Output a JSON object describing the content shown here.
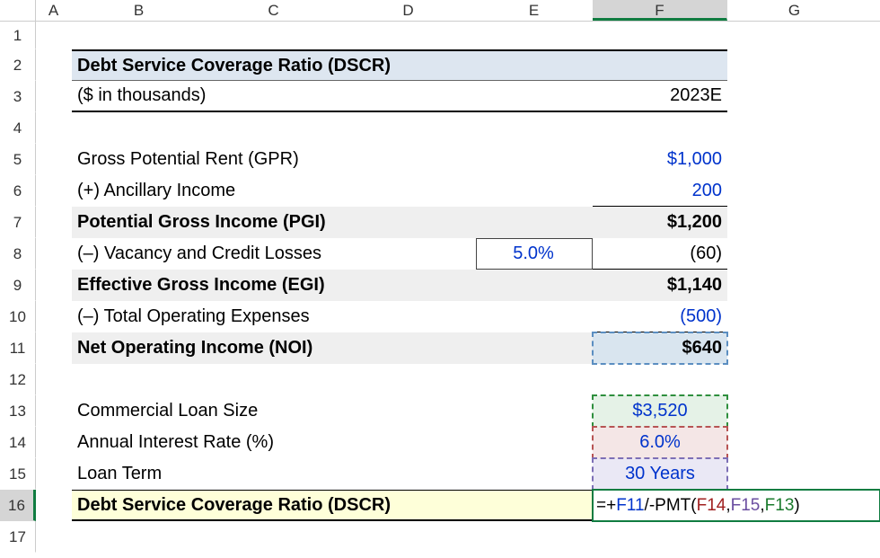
{
  "columns": [
    "A",
    "B",
    "C",
    "D",
    "E",
    "F",
    "G"
  ],
  "sel_col": "F",
  "sel_row": "16",
  "rows": {
    "r2": {
      "title": "Debt Service Coverage Ratio (DSCR)"
    },
    "r3": {
      "label": "($ in thousands)",
      "year": "2023E"
    },
    "r5": {
      "label": "Gross Potential Rent (GPR)",
      "val": "$1,000"
    },
    "r6": {
      "label": "(+) Ancillary Income",
      "val": "200"
    },
    "r7": {
      "label": "Potential Gross Income (PGI)",
      "val": "$1,200"
    },
    "r8": {
      "label": "(–) Vacancy and Credit Losses",
      "pct": "5.0%",
      "val": "(60)"
    },
    "r9": {
      "label": "Effective Gross Income (EGI)",
      "val": "$1,140"
    },
    "r10": {
      "label": "(–) Total Operating Expenses",
      "val": "(500)"
    },
    "r11": {
      "label": "Net Operating Income (NOI)",
      "val": "$640"
    },
    "r13": {
      "label": "Commercial Loan Size",
      "val": "$3,520"
    },
    "r14": {
      "label": "Annual Interest Rate (%)",
      "val": "6.0%"
    },
    "r15": {
      "label": "Loan Term",
      "val": "30 Years"
    },
    "r16": {
      "label": "Debt Service Coverage Ratio (DSCR)"
    }
  },
  "formula": {
    "prefix": "=+",
    "ref1": "F11",
    "mid": "/-PMT(",
    "ref2": "F14",
    "c1": ",",
    "ref3": "F15",
    "c2": ",",
    "ref4": "F13",
    "suffix": ")"
  },
  "row_numbers": [
    "1",
    "2",
    "3",
    "4",
    "5",
    "6",
    "7",
    "8",
    "9",
    "10",
    "11",
    "12",
    "13",
    "14",
    "15",
    "16",
    "17"
  ]
}
